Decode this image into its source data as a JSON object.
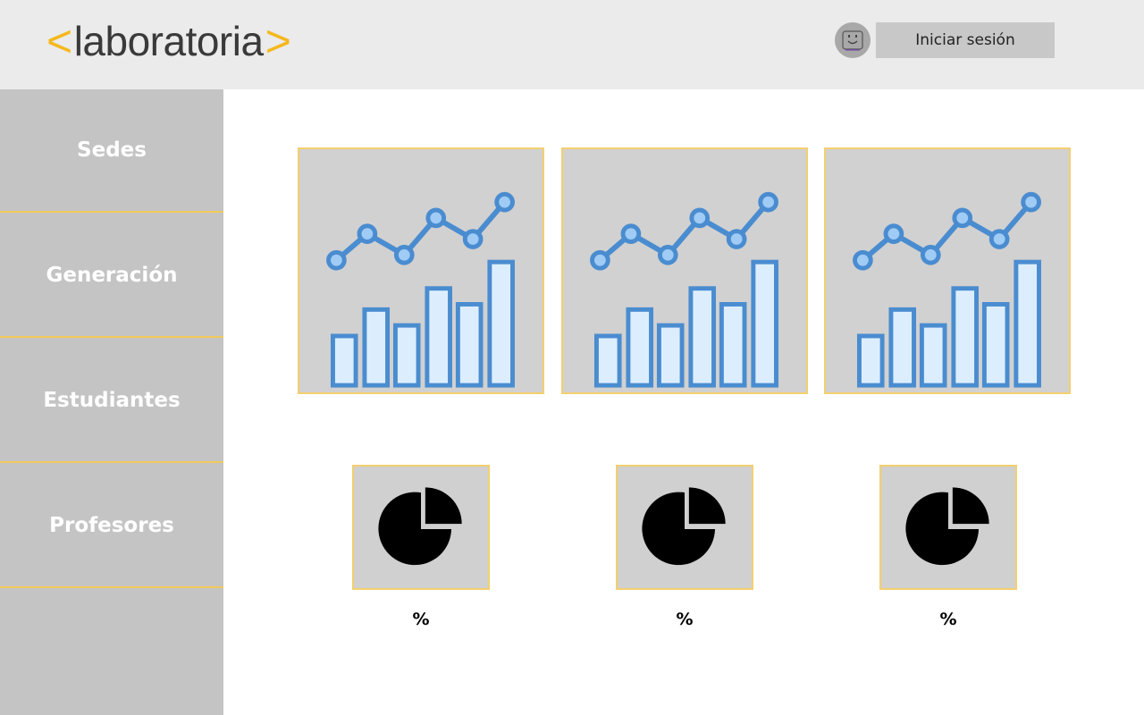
{
  "header": {
    "logo": {
      "left_bracket": "<",
      "word": "laboratoria",
      "right_bracket": ">"
    },
    "avatar_icon": "smiley-face-icon",
    "login_label": "Iniciar sesión"
  },
  "sidebar": {
    "items": [
      {
        "label": "Sedes"
      },
      {
        "label": "Generación"
      },
      {
        "label": "Estudiantes"
      },
      {
        "label": "Profesores"
      },
      {
        "label": ""
      }
    ]
  },
  "main": {
    "chart_icon": "bar-line-chart-icon",
    "pie_icon": "pie-chart-icon",
    "pie_cards": [
      {
        "label": "%"
      },
      {
        "label": "%"
      },
      {
        "label": "%"
      }
    ]
  },
  "colors": {
    "header_bg": "#ebebeb",
    "sidebar_bg": "#c4c4c4",
    "accent": "#f5b81d",
    "chart_stroke": "#4a8cd0",
    "chart_fill": "#dceefd",
    "card_bg": "#d1d1d1"
  }
}
